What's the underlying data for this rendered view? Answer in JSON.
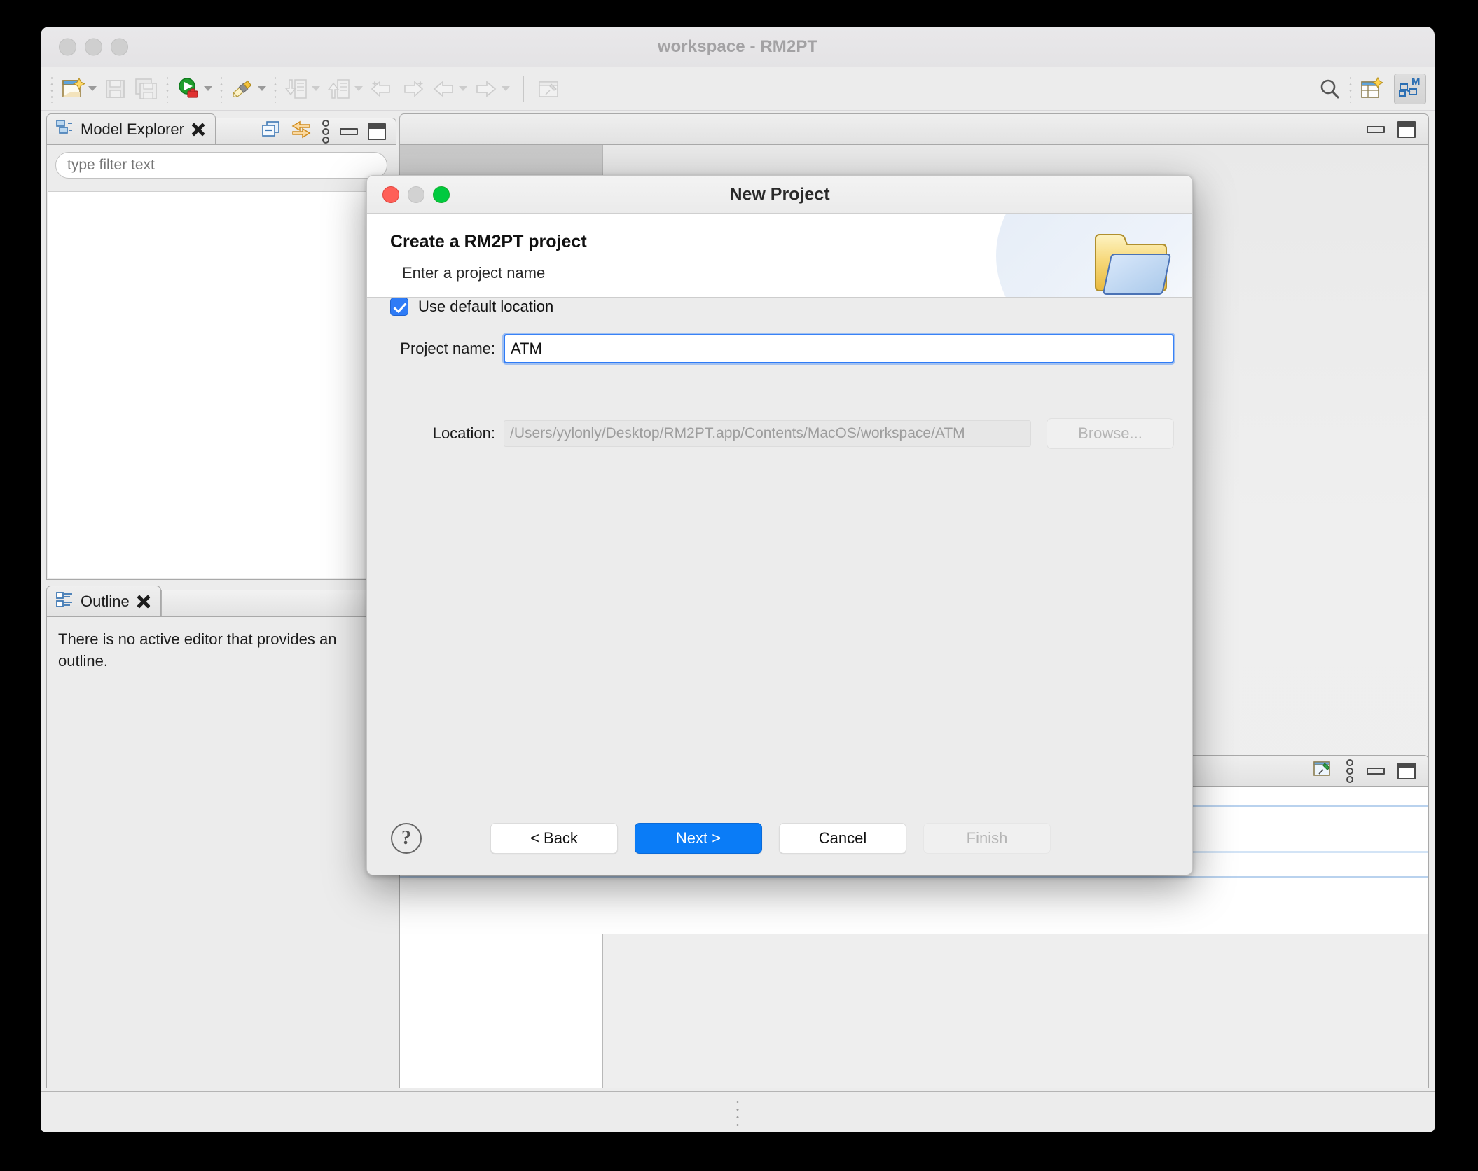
{
  "window": {
    "title": "workspace - RM2PT",
    "traffic_lights": [
      "close",
      "minimize",
      "zoom"
    ]
  },
  "toolbar": {
    "items": [
      {
        "name": "new-wizard",
        "icon": "new-file-icon",
        "caret": true,
        "enabled": true
      },
      {
        "name": "save",
        "icon": "save-icon",
        "caret": false,
        "enabled": false
      },
      {
        "name": "save-all",
        "icon": "save-all-icon",
        "caret": false,
        "enabled": false
      },
      {
        "name": "run",
        "icon": "run-icon",
        "caret": true,
        "enabled": true
      },
      {
        "name": "validate",
        "icon": "pen-icon",
        "caret": true,
        "enabled": true
      },
      {
        "name": "import",
        "icon": "import-icon",
        "caret": true,
        "enabled": false
      },
      {
        "name": "export",
        "icon": "export-icon",
        "caret": true,
        "enabled": false
      },
      {
        "name": "previous-annotation",
        "icon": "previous-annotation-icon",
        "caret": false,
        "enabled": false
      },
      {
        "name": "next-annotation",
        "icon": "next-annotation-icon",
        "caret": false,
        "enabled": false
      },
      {
        "name": "back",
        "icon": "back-arrow-icon",
        "caret": true,
        "enabled": false
      },
      {
        "name": "forward",
        "icon": "forward-arrow-icon",
        "caret": true,
        "enabled": false
      },
      {
        "name": "pin-editor",
        "icon": "pin-editor-icon",
        "caret": false,
        "enabled": false
      }
    ],
    "right": {
      "search": "search-icon",
      "open-perspective": "open-perspective-icon",
      "active_perspective": "modeling-perspective-icon",
      "active_perspective_letter": "M"
    }
  },
  "model_explorer": {
    "tab_label": "Model Explorer",
    "tab_icon": "model-explorer-icon",
    "toolbar_icons": [
      "collapse-all-icon",
      "link-with-editor-icon",
      "view-menu-icon"
    ],
    "filter_placeholder": "type filter text",
    "filter_value": "",
    "tree_items": []
  },
  "outline": {
    "tab_label": "Outline",
    "tab_icon": "outline-icon",
    "message": "There is no active editor that provides an outline."
  },
  "editor_area": {
    "minimize_label": "Minimize",
    "maximize_label": "Maximize"
  },
  "bottom_view": {
    "pin_icon": "pin-view-icon",
    "menu_icon": "view-menu-icon",
    "minimize_label": "Minimize",
    "maximize_label": "Maximize"
  },
  "dialog": {
    "window_title": "New Project",
    "heading": "Create a RM2PT project",
    "subheading": "Enter a project name",
    "header_icon": "folder-icon",
    "fields": {
      "project_name_label": "Project name:",
      "project_name_value": "ATM",
      "use_default_location_label": "Use default location",
      "use_default_location_checked": true,
      "location_label": "Location:",
      "location_value": "/Users/yylonly/Desktop/RM2PT.app/Contents/MacOS/workspace/ATM",
      "browse_label": "Browse..."
    },
    "footer": {
      "help_label": "?",
      "back_label": "< Back",
      "next_label": "Next >",
      "cancel_label": "Cancel",
      "finish_label": "Finish"
    },
    "traffic_lights": {
      "close_color": "#ff5f57",
      "minimize_color": "#d2d2d2",
      "zoom_color": "#00ca3f"
    }
  },
  "colors": {
    "accent_blue": "#0a7cf7",
    "focus_border": "#2e7bf6",
    "window_bg": "#ececec",
    "title_text": "#a3a2a4"
  }
}
